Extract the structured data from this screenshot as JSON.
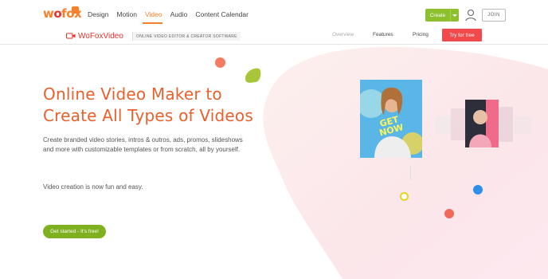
{
  "brand": {
    "logo_text_a": "w",
    "logo_text_o": "o",
    "logo_text_b": "fox",
    "color_orange": "#f7812a",
    "color_red": "#e8312b",
    "color_green": "#8dbf2e"
  },
  "nav": {
    "items": [
      {
        "label": "Design",
        "active": false
      },
      {
        "label": "Motion",
        "active": false
      },
      {
        "label": "Video",
        "active": true
      },
      {
        "label": "Audio",
        "active": false
      },
      {
        "label": "Content Calendar",
        "active": false
      }
    ],
    "create_label": "Create",
    "join_label": "JOIN"
  },
  "subnav": {
    "product_prefix": "WoFox",
    "product_suffix": "Video",
    "tagline": "ONLINE VIDEO EDITOR & CREATOR SOFTWARE",
    "overview": "Overview",
    "features": "Features",
    "pricing": "Pricing",
    "try_label": "Try for free"
  },
  "hero": {
    "title_line1": "Online Video Maker to",
    "title_line2": "Create All Types of Videos",
    "description": "Create branded video stories, intros & outros, ads, promos, slideshows and more with customizable templates or from scratch, all by yourself.",
    "note": "Video creation is now fun and easy.",
    "cta_label": "Get started - It's free!",
    "card_text_1": "GET",
    "card_text_2": "NOW"
  },
  "icons": {
    "user": "user-icon",
    "camera": "video-camera-icon",
    "caret": "chevron-down-icon"
  }
}
